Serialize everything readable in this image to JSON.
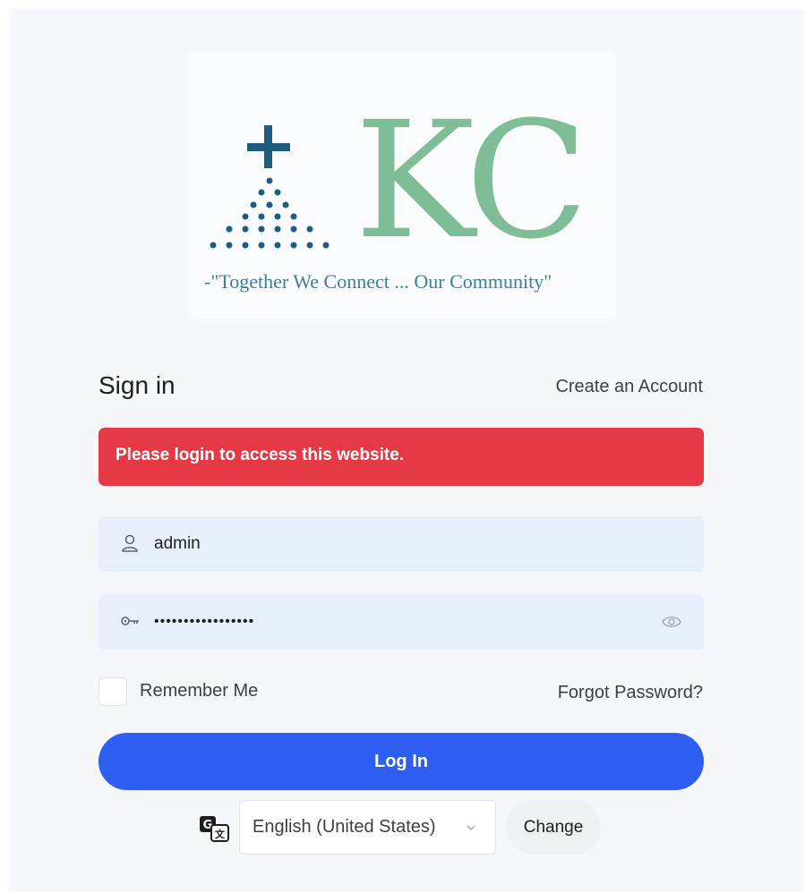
{
  "logo": {
    "letters": "KC",
    "tagline": "-\"Together We Connect ... Our Community\""
  },
  "signin": {
    "title": "Sign in",
    "create_account": "Create an Account"
  },
  "alert": {
    "message": "Please login to access this website."
  },
  "username": {
    "value": "admin",
    "icon": "user-icon"
  },
  "password": {
    "value": "•••••••••••••••••",
    "icon": "key-icon",
    "toggle_icon": "eye-icon"
  },
  "remember": {
    "label": "Remember Me",
    "checked": false
  },
  "forgot": {
    "label": "Forgot Password?"
  },
  "login_button": {
    "label": "Log In"
  },
  "language": {
    "icon": "translate-icon",
    "selected": "English (United States)",
    "change_label": "Change"
  },
  "colors": {
    "alert": "#e63946",
    "primary": "#2f5ff2",
    "logo_green": "#7fbd97",
    "logo_blue": "#1f5d80"
  }
}
